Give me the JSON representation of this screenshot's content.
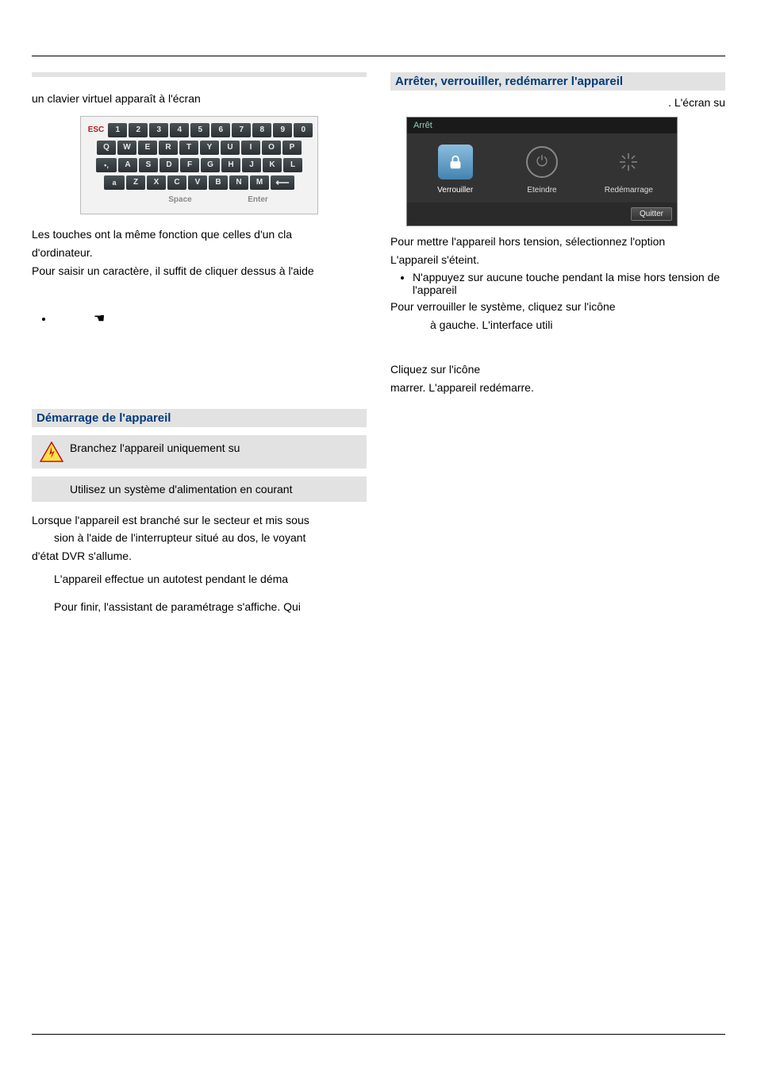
{
  "left": {
    "gray_placeholder": " ",
    "intro": "un clavier virtuel apparaît à l'écran",
    "keyboard": {
      "row1": [
        "ESC",
        "1",
        "2",
        "3",
        "4",
        "5",
        "6",
        "7",
        "8",
        "9",
        "0"
      ],
      "row2": [
        "Q",
        "W",
        "E",
        "R",
        "T",
        "Y",
        "U",
        "I",
        "O",
        "P"
      ],
      "row3_prefix": "•,",
      "row3": [
        "A",
        "S",
        "D",
        "F",
        "G",
        "H",
        "J",
        "K",
        "L"
      ],
      "row4_prefix": "a",
      "row4": [
        "Z",
        "X",
        "C",
        "V",
        "B",
        "N",
        "M"
      ],
      "row4_arrow": "⟵",
      "row5_space": "Space",
      "row5_enter": "Enter"
    },
    "para_keys_same": "Les touches ont la même fonction que celles d'un cla",
    "para_dordinateur": "d'ordinateur.",
    "para_input_char": "Pour saisir un caractère, il suffit de cliquer dessus à l'aide",
    "bullet_hand": "☚",
    "heading_startup": "Démarrage de l'appareil",
    "warn1": "Branchez l'appareil uniquement su",
    "warn2": "Utilisez un système d'alimentation en courant",
    "para_when_plugged": "Lorsque l'appareil est branché sur le secteur et mis sous",
    "para_sion": "sion à l'aide de l'interrupteur situé au dos, le voyant",
    "para_dvr": "d'état DVR s'allume.",
    "para_autotest": "L'appareil effectue un autotest pendant le déma",
    "para_finally": "Pour finir, l'assistant de paramétrage s'affiche. Qui"
  },
  "right": {
    "heading_shutdown": "Arrêter, verrouiller, redémarrer l'appareil",
    "screen_su": ". L'écran su",
    "dialog": {
      "title": "Arrêt",
      "lock": "Verrouiller",
      "power": "Eteindre",
      "restart": "Redémarrage",
      "quit": "Quitter"
    },
    "para_power_off": "Pour mettre l'appareil hors tension, sélectionnez l'option",
    "para_device_off": "L'appareil s'éteint.",
    "bullet_no_press": "N'appuyez sur aucune touche pendant la mise hors tension de l'appareil",
    "para_lock_1": "Pour verrouiller le système, cliquez sur l'icône",
    "para_lock_2": "à gauche. L'interface utili",
    "para_click_icon": "Cliquez sur l'icône",
    "para_restart": "marrer. L'appareil redémarre."
  }
}
